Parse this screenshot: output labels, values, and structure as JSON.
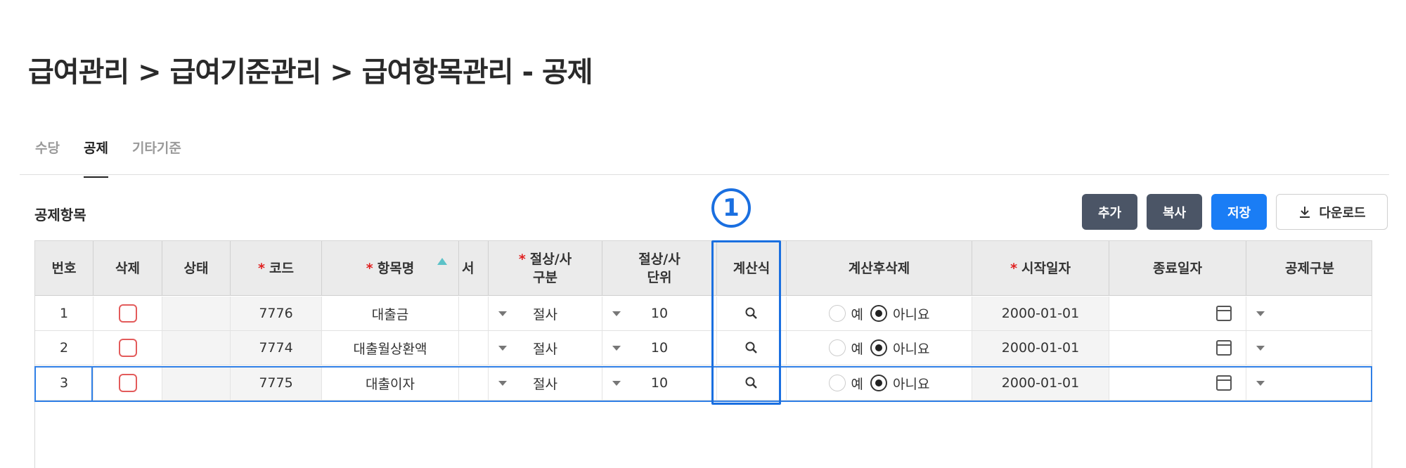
{
  "page": {
    "title": "급여관리 > 급여기준관리 > 급여항목관리 - 공제"
  },
  "tabs": [
    {
      "label": "수당"
    },
    {
      "label": "공제",
      "active": true
    },
    {
      "label": "기타기준"
    }
  ],
  "section": {
    "title": "공제항목"
  },
  "buttons": {
    "add": "추가",
    "copy": "복사",
    "save": "저장",
    "download": "다운로드"
  },
  "columns": {
    "no": "번호",
    "delete": "삭제",
    "status": "상태",
    "code": "코드",
    "name": "항목명",
    "order": "서",
    "round_type_1": "절상/사",
    "round_type_2": "구분",
    "round_unit_1": "절상/사",
    "round_unit_2": "단위",
    "formula": "계산식",
    "delete_after_calc": "계산후삭제",
    "start_date": "시작일자",
    "end_date": "종료일자",
    "deduction_type": "공제구분"
  },
  "radio_labels": {
    "yes": "예",
    "no": "아니요"
  },
  "rows": [
    {
      "no": "1",
      "code": "7776",
      "name": "대출금",
      "round_type": "절사",
      "round_unit": "10",
      "start_date": "2000-01-01"
    },
    {
      "no": "2",
      "code": "7774",
      "name": "대출월상환액",
      "round_type": "절사",
      "round_unit": "10",
      "start_date": "2000-01-01"
    },
    {
      "no": "3",
      "code": "7775",
      "name": "대출이자",
      "round_type": "절사",
      "round_unit": "10",
      "start_date": "2000-01-01"
    }
  ],
  "annotation": {
    "marker": "1"
  },
  "colors": {
    "accent": "#1a7df5",
    "dark_button": "#4b5566",
    "required": "#e02020"
  }
}
